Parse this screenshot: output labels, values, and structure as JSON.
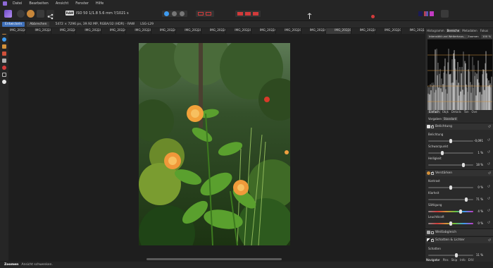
{
  "menu": [
    "Datei",
    "Bearbeiten",
    "Ansicht",
    "Fenster",
    "Hilfe"
  ],
  "toolbar": {
    "raw_badge": "RAW",
    "camera_info": "ISO 50 1/1.8 5.6 mm ?/1021 s"
  },
  "context": {
    "develop_label": "Entwickeln",
    "cancel_label": "Abbrechen",
    "image_info": "5472 × 7296 px, 39.92 MP, RGBA/32 (HDR) - RAW",
    "profile": "LSG-L29"
  },
  "tabs": [
    "IMG_20210...",
    "IMG_20210...",
    "IMG_20210...",
    "IMG_20210...",
    "IMG_20210...",
    "IMG_20210...",
    "IMG_20210...",
    "IMG_20210...",
    "IMG_20210...",
    "IMG_20210...",
    "IMG_20210...",
    "IMG_20210...",
    "IMG_20210...",
    "IMG_20210...",
    "IMG_20210...",
    "IMG_20210...",
    "IMG_20210..."
  ],
  "selected_tab_index": 13,
  "panel": {
    "top_tabs": [
      "Histogramm",
      "Bereiche",
      "Metadaten",
      "Fokus"
    ],
    "histogram_mode": "Intensität und Weiterhaus...",
    "histogram_zoom_label": "Zoomen",
    "histogram_zoom_value": "100 %",
    "tabs2": [
      "Einfach",
      "Objk",
      "Details",
      "Ton",
      "Ove"
    ],
    "preset_label": "Vorgaben",
    "preset_value": "Standard",
    "sections": {
      "belichtung": "Belichtung",
      "verstaerken": "Verstärken",
      "weissabgleich": "Weißabgleich",
      "schatten": "Schatten & Lichter"
    },
    "sliders": {
      "belichtung_label": "Belichtung",
      "belichtung_value": "-0,091",
      "schwarzpunkt_label": "Schwarzpunkt",
      "schwarzpunkt_value": "1 %",
      "helligkeit_label": "Helligkeit",
      "helligkeit_value": "18 %",
      "kontrast_label": "Kontrast",
      "kontrast_value": "0 %",
      "klarheit_label": "Klarheit",
      "klarheit_value": "71 %",
      "saettigung_label": "Sättigung",
      "saettigung_value": "4 %",
      "leuchtkraft_label": "Leuchtkraft",
      "leuchtkraft_value": "0 %",
      "schatten_label": "Schatten",
      "schatten_value": "11 %"
    },
    "bottom_tabs": [
      "Navigator",
      "Pins",
      "Skip",
      "Info",
      "EXV"
    ]
  },
  "status": {
    "bold": "Zoomen",
    "text": "Ansicht schwenken."
  },
  "colors": {
    "accent": "#3e6fb8",
    "persona": "#8e6ad8",
    "histogram_line": "#d4913a"
  }
}
